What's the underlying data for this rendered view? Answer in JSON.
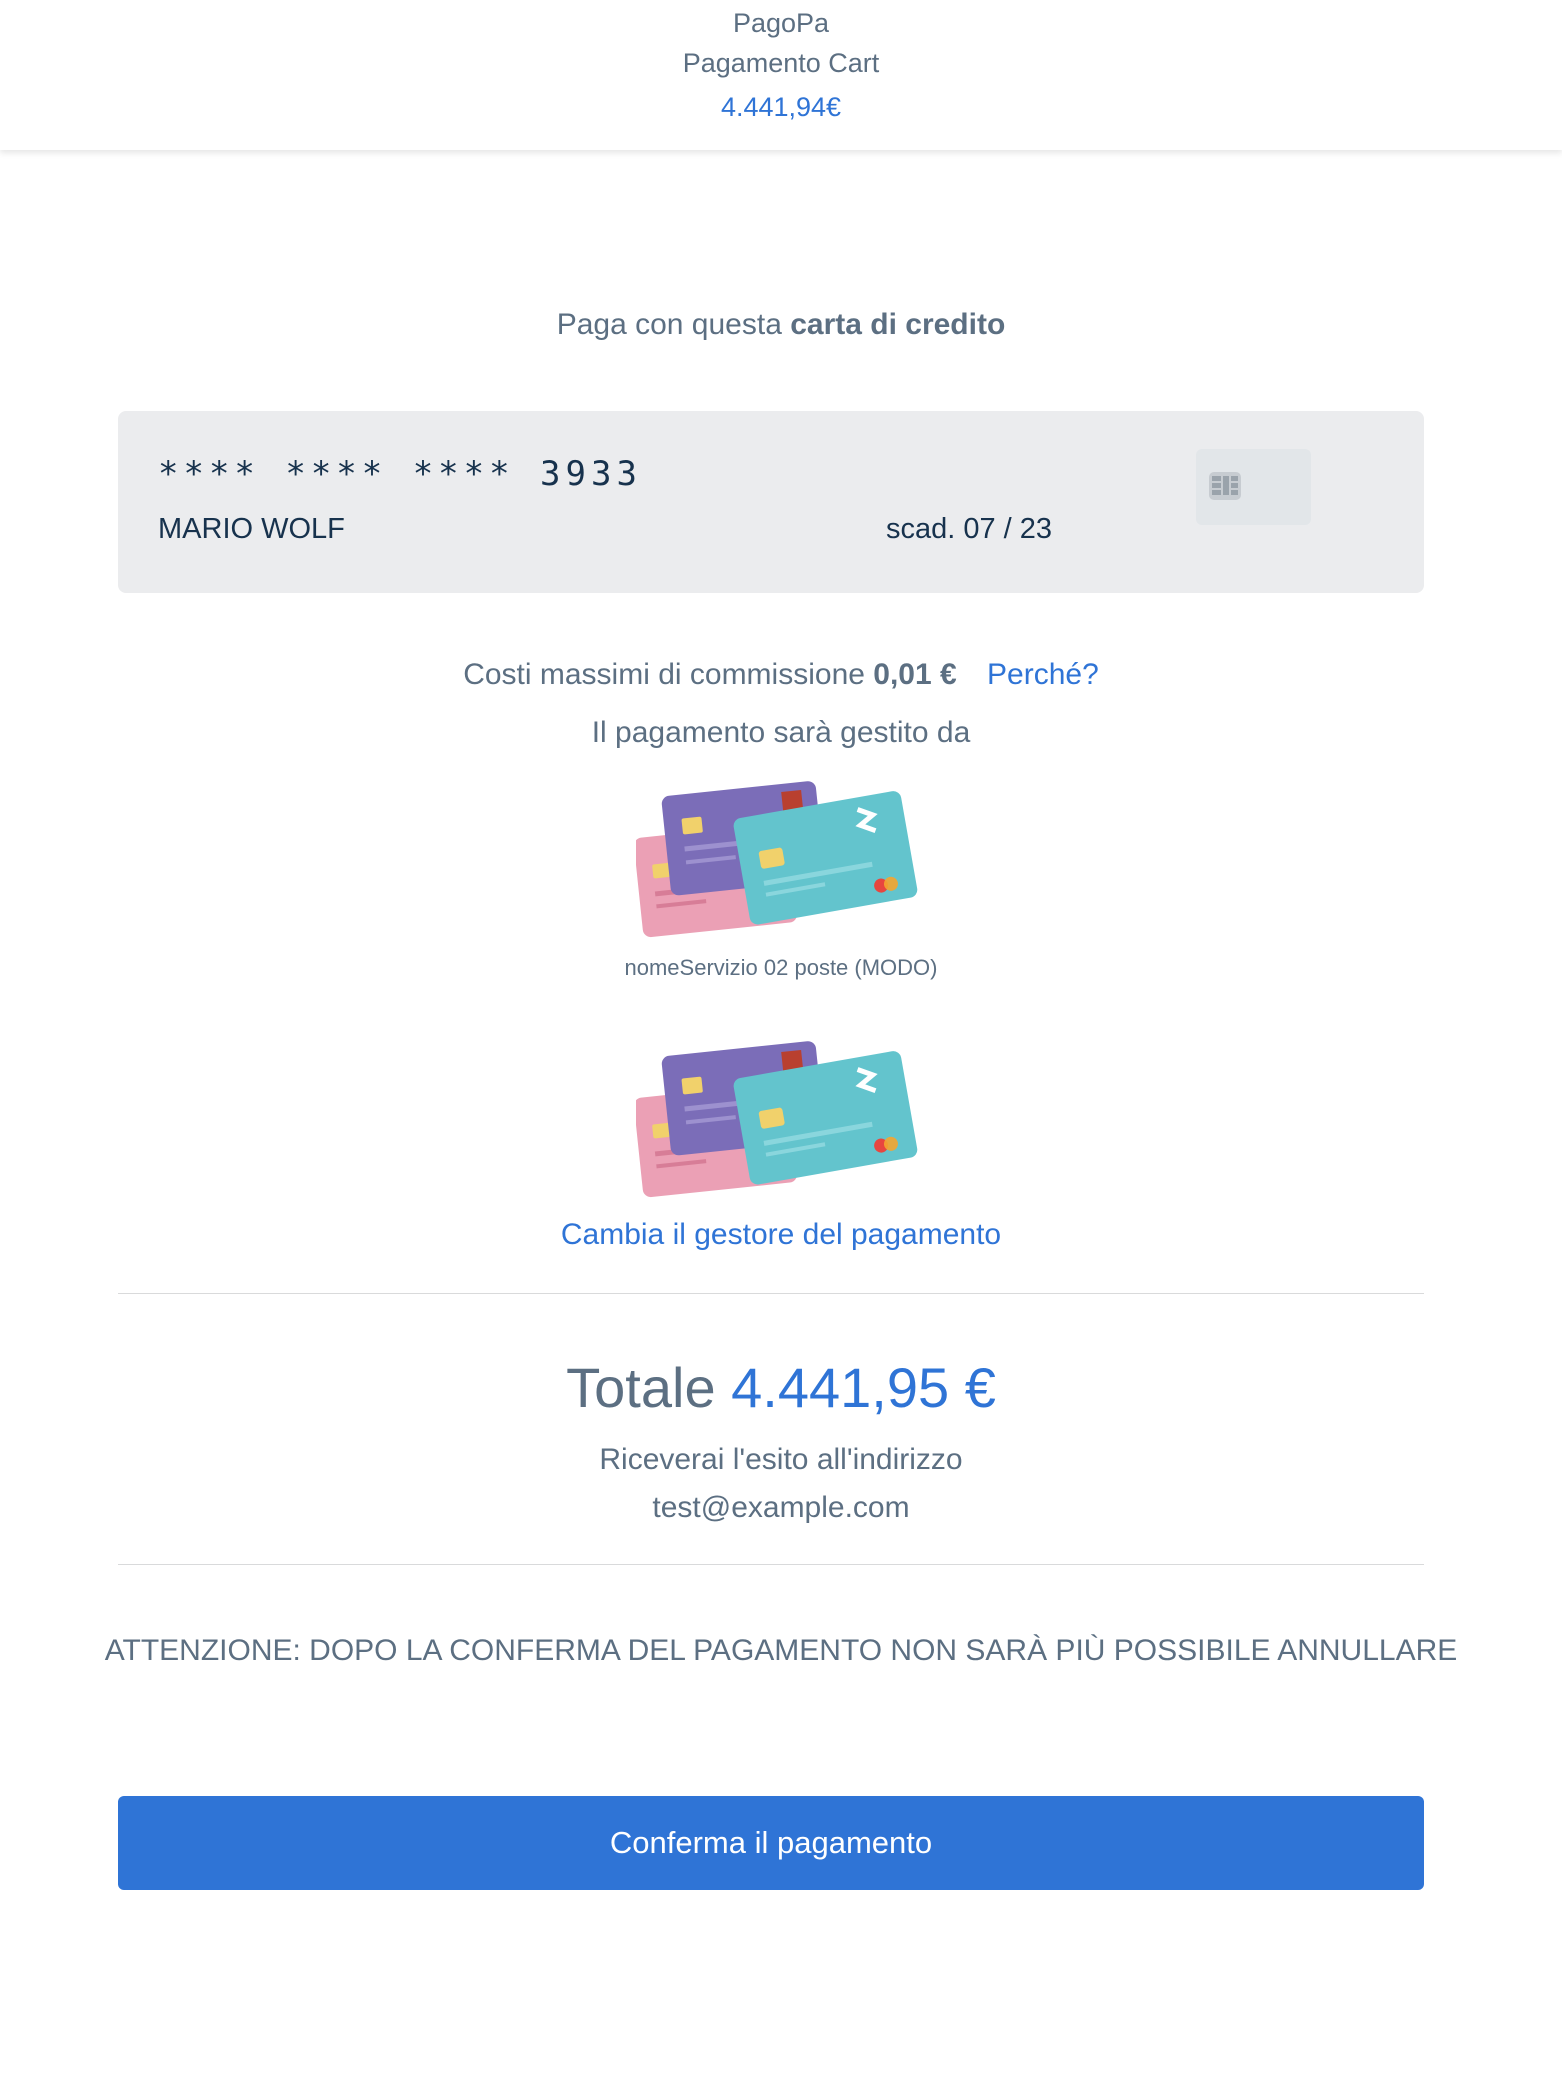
{
  "header": {
    "app_name": "PagoPa",
    "subtitle": "Pagamento Cart",
    "amount": "4.441,94€"
  },
  "intro": {
    "prefix": "Paga con questa ",
    "bold": "carta di credito"
  },
  "card": {
    "masked_number": "**** **** **** 3933",
    "holder": "MARIO WOLF",
    "expiry": "scad. 07 / 23",
    "chip_icon": "card-chip-icon"
  },
  "fees": {
    "label": "Costi massimi di commissione",
    "amount": "0,01 €",
    "why_link": "Perché?"
  },
  "managed_by": "Il pagamento sarà gestito da",
  "psp": {
    "name": "nomeServizio 02 poste (MODO)",
    "change_link": "Cambia il gestore del pagamento"
  },
  "total": {
    "label": "Totale",
    "value": "4.441,95 €"
  },
  "receipt": {
    "text": "Riceverai l'esito all'indirizzo",
    "email": "test@example.com"
  },
  "warning": "ATTENZIONE: DOPO LA CONFERMA DEL PAGAMENTO NON SARÀ PIÙ POSSIBILE ANNULLARE",
  "confirm_button": "Conferma il pagamento",
  "colors": {
    "accent": "#2f74d6",
    "text": "#5c6f82",
    "card_bg": "#ebecee"
  }
}
